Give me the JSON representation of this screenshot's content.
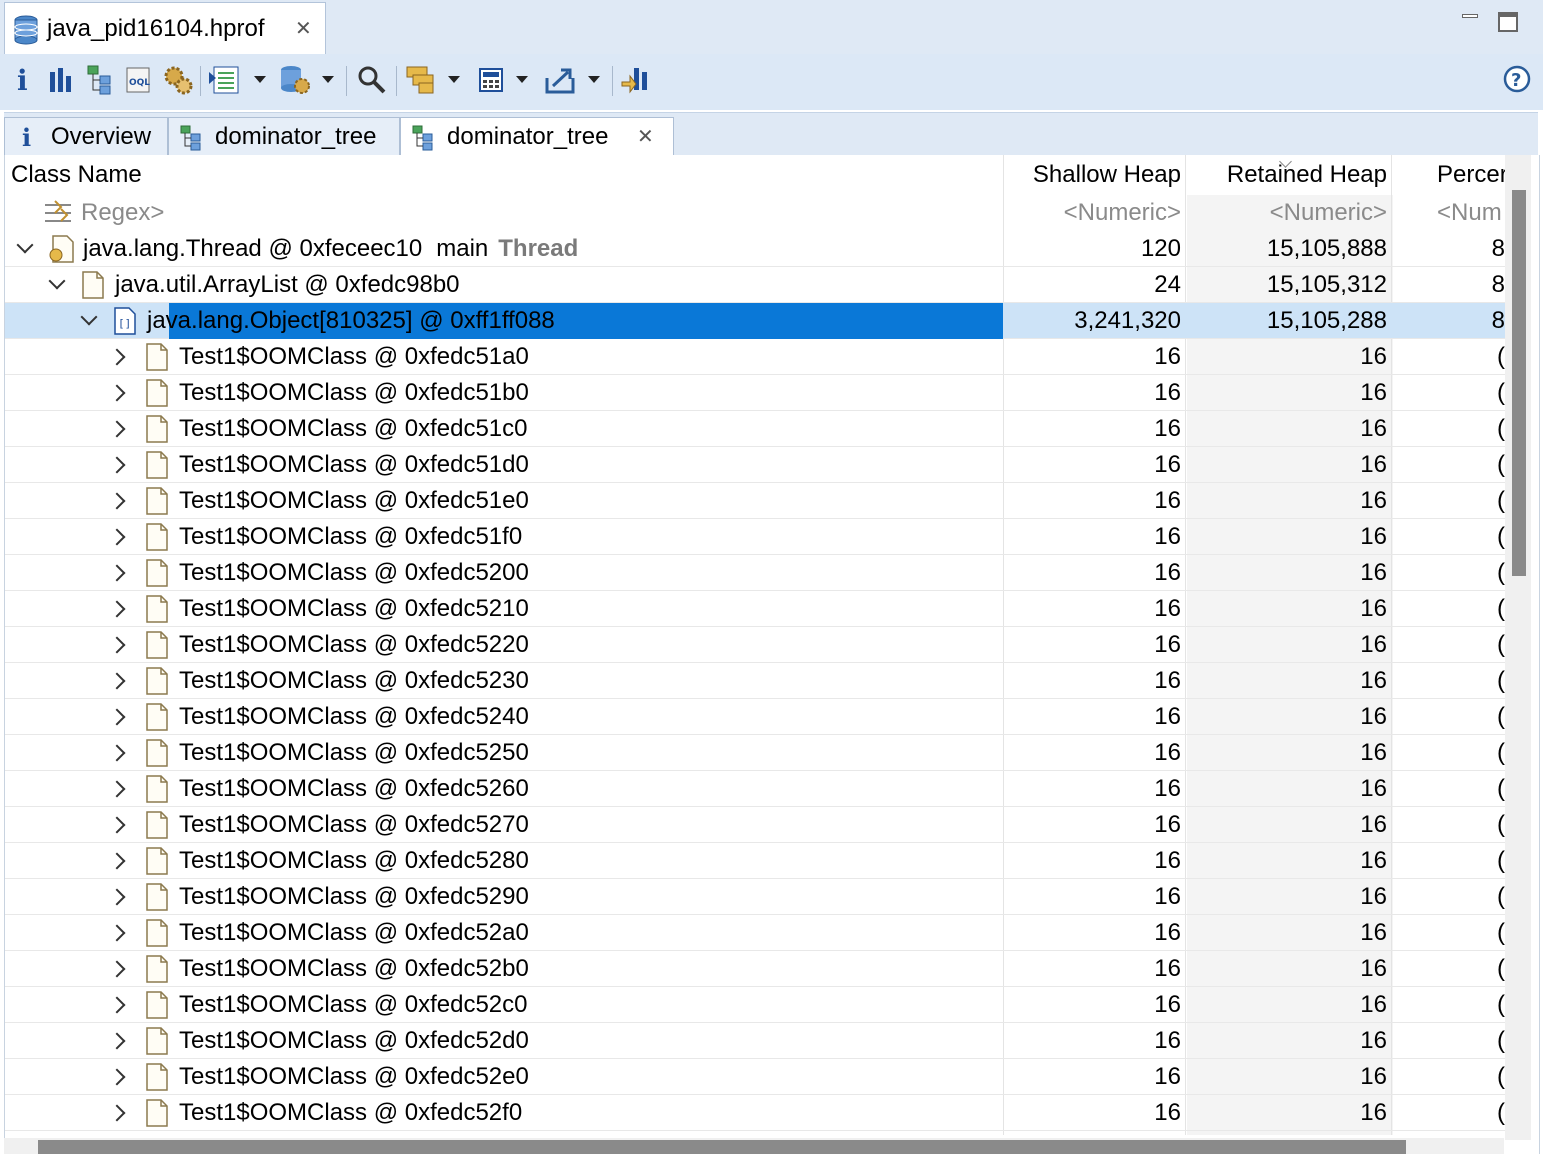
{
  "editor": {
    "tab_title": "java_pid16104.hprof"
  },
  "toolbar": {
    "buttons": [
      "info-icon",
      "histogram-icon",
      "dominator-tree-icon",
      "oql-icon",
      "thread-overview-icon",
      "run-report-icon",
      "heap-dump-overview-icon",
      "search-icon",
      "group-by-icon",
      "calculate-retained-icon",
      "export-icon",
      "pin-icon",
      "help-icon"
    ]
  },
  "content_tabs": [
    {
      "label": "Overview",
      "icon": "info-icon"
    },
    {
      "label": "dominator_tree",
      "icon": "dominator-tree-icon"
    },
    {
      "label": "dominator_tree",
      "icon": "dominator-tree-icon",
      "active": true
    }
  ],
  "table": {
    "columns": {
      "class_name": "Class Name",
      "shallow_heap": "Shallow Heap",
      "retained_heap": "Retained Heap",
      "percentage": "Percer"
    },
    "filters": {
      "class_name": "Regex>",
      "shallow_heap": "<Numeric>",
      "retained_heap": "<Numeric>",
      "percentage": "<Num"
    },
    "rows": [
      {
        "depth": 0,
        "expanded": true,
        "icon": "thread-object-icon",
        "name": "java.lang.Thread @ 0xfeceec10",
        "extra": "main",
        "tag": "Thread",
        "shallow": "120",
        "retained": "15,105,888",
        "pct": "8"
      },
      {
        "depth": 1,
        "expanded": true,
        "icon": "object-icon",
        "name": "java.util.ArrayList @ 0xfedc98b0",
        "shallow": "24",
        "retained": "15,105,312",
        "pct": "8"
      },
      {
        "depth": 2,
        "expanded": true,
        "selected": true,
        "icon": "array-icon",
        "name": "java.lang.Object[810325] @ 0xff1ff088",
        "shallow": "3,241,320",
        "retained": "15,105,288",
        "pct": "8"
      },
      {
        "depth": 3,
        "icon": "object-icon",
        "name": "Test1$OOMClass @ 0xfedc51a0",
        "shallow": "16",
        "retained": "16",
        "pct": "("
      },
      {
        "depth": 3,
        "icon": "object-icon",
        "name": "Test1$OOMClass @ 0xfedc51b0",
        "shallow": "16",
        "retained": "16",
        "pct": "("
      },
      {
        "depth": 3,
        "icon": "object-icon",
        "name": "Test1$OOMClass @ 0xfedc51c0",
        "shallow": "16",
        "retained": "16",
        "pct": "("
      },
      {
        "depth": 3,
        "icon": "object-icon",
        "name": "Test1$OOMClass @ 0xfedc51d0",
        "shallow": "16",
        "retained": "16",
        "pct": "("
      },
      {
        "depth": 3,
        "icon": "object-icon",
        "name": "Test1$OOMClass @ 0xfedc51e0",
        "shallow": "16",
        "retained": "16",
        "pct": "("
      },
      {
        "depth": 3,
        "icon": "object-icon",
        "name": "Test1$OOMClass @ 0xfedc51f0",
        "shallow": "16",
        "retained": "16",
        "pct": "("
      },
      {
        "depth": 3,
        "icon": "object-icon",
        "name": "Test1$OOMClass @ 0xfedc5200",
        "shallow": "16",
        "retained": "16",
        "pct": "("
      },
      {
        "depth": 3,
        "icon": "object-icon",
        "name": "Test1$OOMClass @ 0xfedc5210",
        "shallow": "16",
        "retained": "16",
        "pct": "("
      },
      {
        "depth": 3,
        "icon": "object-icon",
        "name": "Test1$OOMClass @ 0xfedc5220",
        "shallow": "16",
        "retained": "16",
        "pct": "("
      },
      {
        "depth": 3,
        "icon": "object-icon",
        "name": "Test1$OOMClass @ 0xfedc5230",
        "shallow": "16",
        "retained": "16",
        "pct": "("
      },
      {
        "depth": 3,
        "icon": "object-icon",
        "name": "Test1$OOMClass @ 0xfedc5240",
        "shallow": "16",
        "retained": "16",
        "pct": "("
      },
      {
        "depth": 3,
        "icon": "object-icon",
        "name": "Test1$OOMClass @ 0xfedc5250",
        "shallow": "16",
        "retained": "16",
        "pct": "("
      },
      {
        "depth": 3,
        "icon": "object-icon",
        "name": "Test1$OOMClass @ 0xfedc5260",
        "shallow": "16",
        "retained": "16",
        "pct": "("
      },
      {
        "depth": 3,
        "icon": "object-icon",
        "name": "Test1$OOMClass @ 0xfedc5270",
        "shallow": "16",
        "retained": "16",
        "pct": "("
      },
      {
        "depth": 3,
        "icon": "object-icon",
        "name": "Test1$OOMClass @ 0xfedc5280",
        "shallow": "16",
        "retained": "16",
        "pct": "("
      },
      {
        "depth": 3,
        "icon": "object-icon",
        "name": "Test1$OOMClass @ 0xfedc5290",
        "shallow": "16",
        "retained": "16",
        "pct": "("
      },
      {
        "depth": 3,
        "icon": "object-icon",
        "name": "Test1$OOMClass @ 0xfedc52a0",
        "shallow": "16",
        "retained": "16",
        "pct": "("
      },
      {
        "depth": 3,
        "icon": "object-icon",
        "name": "Test1$OOMClass @ 0xfedc52b0",
        "shallow": "16",
        "retained": "16",
        "pct": "("
      },
      {
        "depth": 3,
        "icon": "object-icon",
        "name": "Test1$OOMClass @ 0xfedc52c0",
        "shallow": "16",
        "retained": "16",
        "pct": "("
      },
      {
        "depth": 3,
        "icon": "object-icon",
        "name": "Test1$OOMClass @ 0xfedc52d0",
        "shallow": "16",
        "retained": "16",
        "pct": "("
      },
      {
        "depth": 3,
        "icon": "object-icon",
        "name": "Test1$OOMClass @ 0xfedc52e0",
        "shallow": "16",
        "retained": "16",
        "pct": "("
      },
      {
        "depth": 3,
        "icon": "object-icon",
        "name": "Test1$OOMClass @ 0xfedc52f0",
        "shallow": "16",
        "retained": "16",
        "pct": "("
      }
    ]
  },
  "colors": {
    "selection": "#0a78d7",
    "selection_row": "#cde3f7",
    "toolbar_bg": "#dce8f6"
  }
}
